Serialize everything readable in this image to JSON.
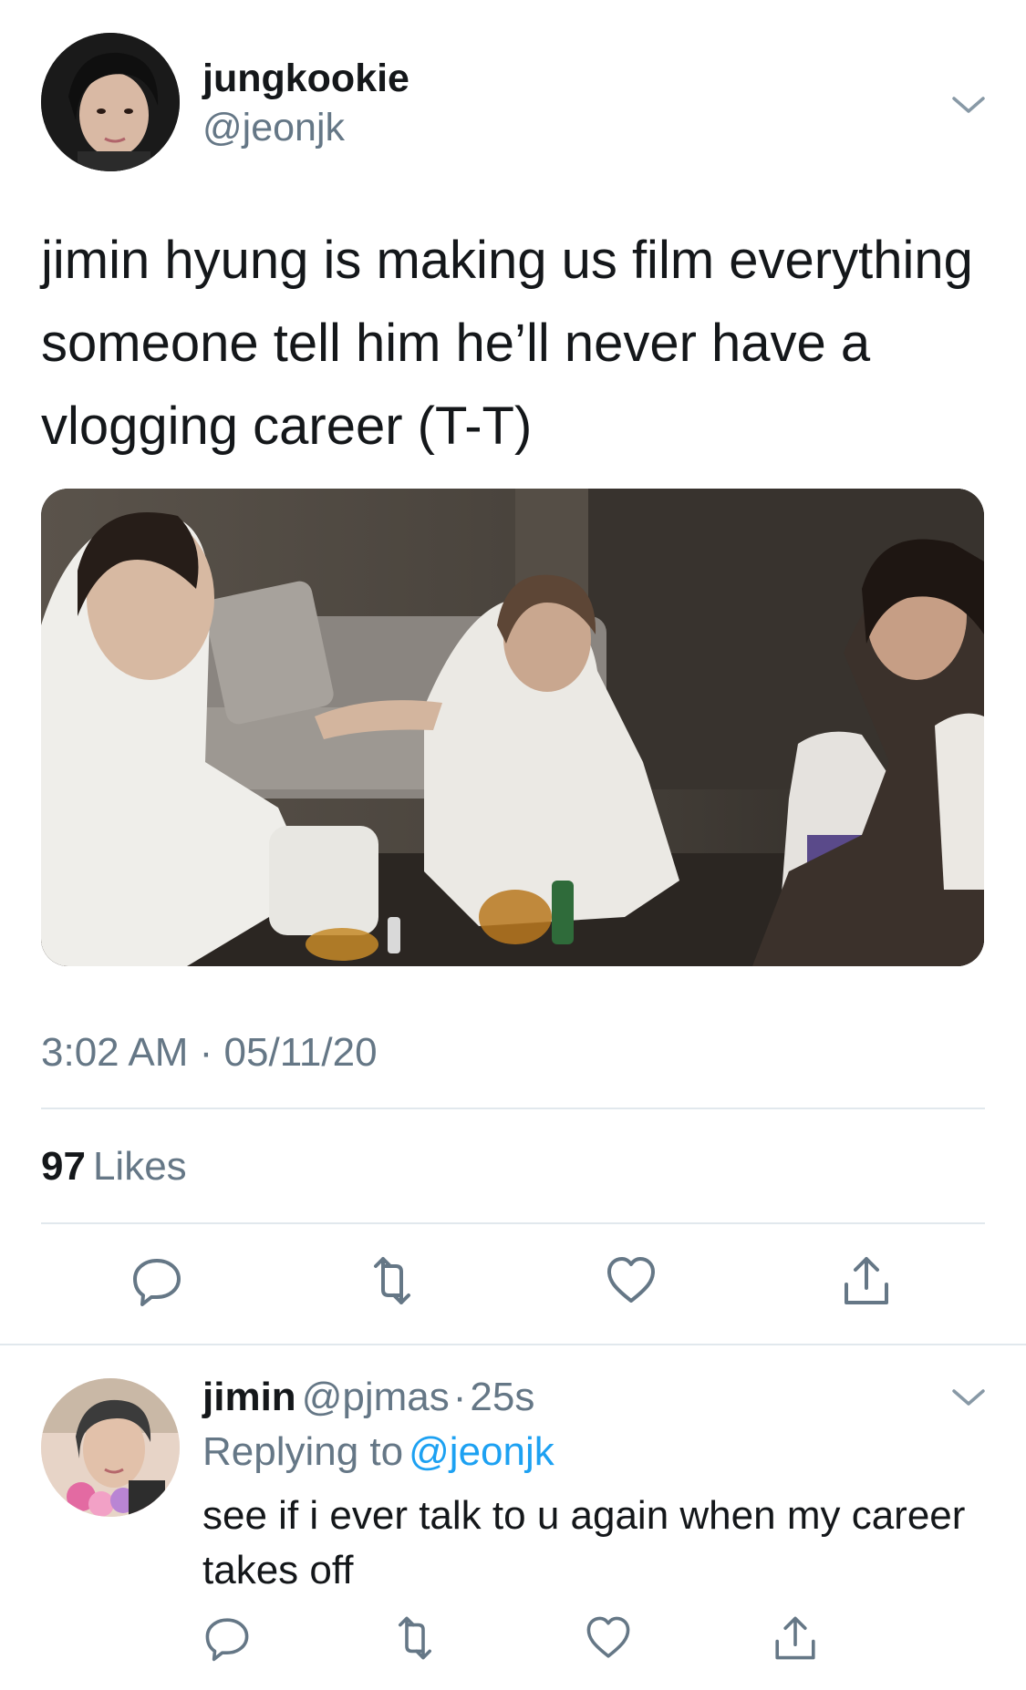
{
  "main_tweet": {
    "display_name": "jungkookie",
    "handle": "@jeonjk",
    "text": "jimin hyung is making us film everything someone tell him he’ll never have a vlogging career (T-T)",
    "timestamp": "3:02 AM · 05/11/20",
    "likes_count": "97",
    "likes_label": "Likes",
    "actions": [
      "reply-icon",
      "retweet-icon",
      "like-icon",
      "share-icon"
    ]
  },
  "reply": {
    "display_name": "jimin",
    "handle": "@pjmas",
    "dot": "·",
    "time": "25s",
    "replying_to_label": "Replying to",
    "replying_to_handle": "@jeonjk",
    "text": "see if i ever talk to u again when my career takes off",
    "actions": [
      "reply-icon",
      "retweet-icon",
      "like-icon",
      "share-icon"
    ]
  },
  "colors": {
    "text_primary": "#14171a",
    "text_secondary": "#657786",
    "link": "#1da1f2",
    "divider": "#e1e8ed",
    "icon": "#657786"
  }
}
